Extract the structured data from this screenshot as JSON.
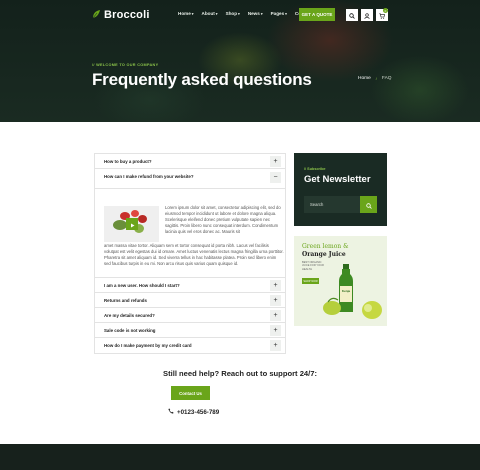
{
  "header": {
    "brand": "Broccoli",
    "menu": [
      {
        "label": "Home",
        "has_caret": true
      },
      {
        "label": "About",
        "has_caret": true
      },
      {
        "label": "Shop",
        "has_caret": true
      },
      {
        "label": "News",
        "has_caret": true
      },
      {
        "label": "Pages",
        "has_caret": true
      },
      {
        "label": "Contact",
        "has_caret": false
      }
    ],
    "cta_label": "GET A QUOTE",
    "cart_count": "0"
  },
  "hero": {
    "eyebrow": "// WELCOME TO OUR COMPANY",
    "title": "Frequently asked questions",
    "breadcrumb_home": "Home",
    "breadcrumb_sep": "/",
    "breadcrumb_current": "FAQ"
  },
  "faq": {
    "items": [
      {
        "question": "How to buy a product?",
        "toggle": "+"
      },
      {
        "question": "How can I make refund from your website?",
        "toggle": "−"
      },
      {
        "question": "I am a new user. How should I start?",
        "toggle": "+"
      },
      {
        "question": "Returns and refunds",
        "toggle": "+"
      },
      {
        "question": "Are my details secured?",
        "toggle": "+"
      },
      {
        "question": "Sale code is not working",
        "toggle": "+"
      },
      {
        "question": "How do I make payment by my credit card",
        "toggle": "+"
      }
    ],
    "answer_part1": "Lorem ipsum dolor sit amet, consectetur adipiscing elit, sed do eiusmod tempor incididunt ut labore et dolore magna aliqua. Scelerisque eleifend donec pretium vulputate sapien nec sagittis. Proin libero nunc consequat interdum. Condimentum lacinia quis vel eros donec ac. Mauris sit",
    "answer_part2": "amet massa vitae tortor. Aliquam sem et tortor consequat id porta nibh. Lacus vel facilisis volutpat est velit egestas dui id ornare. Amet luctus venenatis lectus magna fringilla urna porttitor. Pharetra sit amet aliquam id. Sed viverra tellus in hac habitasse platea. Proin sed libero enim sed faucibus turpis in eu mi. Non arcu risus quis varius quam quisque id."
  },
  "newsletter": {
    "eyebrow": "// Subscribe",
    "title": "Get Newsletter",
    "placeholder": "Search"
  },
  "promo": {
    "line1": "Green lemon &",
    "line2": "Orange Juice",
    "small": "BEST ORGANIC JUICE FOR YOUR HEALTH",
    "button": "SHOP NOW",
    "bottle_label": "Kenja"
  },
  "support": {
    "title": "Still need help? Reach out to support 24/7:",
    "button": "Contact Us",
    "phone": "+0123-456-789"
  },
  "colors": {
    "accent": "#6aa51a",
    "dark": "#1a2b24"
  }
}
